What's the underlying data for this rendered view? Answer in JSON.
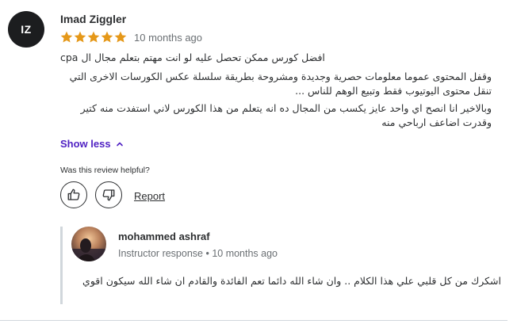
{
  "review": {
    "avatar_initials": "IZ",
    "reviewer_name": "Imad Ziggler",
    "rating": 5,
    "rating_max": 5,
    "time_ago": "10 months ago",
    "paragraphs": [
      "افضل كورس ممكن تحصل عليه لو انت مهتم بتعلم مجال ال cpa",
      "وقفل المحتوى عموما معلومات حصرية وجديدة ومشروحة بطريقة سلسلة عكس الكورسات الاخرى التي تنقل محتوى اليوتيوب فقط وتبيع الوهم للناس ...",
      "وبالاخير انا انصح اي واحد عايز يكسب من المجال ده انه يتعلم من هذا الكورس لاني استفدت منه كتير وقدرت اضاعف ارباحي منه"
    ],
    "show_less_label": "Show less",
    "helpful_question": "Was this review helpful?",
    "report_label": "Report",
    "star_color": "#e59819"
  },
  "instructor_response": {
    "name": "mohammed ashraf",
    "meta": "Instructor response • 10 months ago",
    "reply": "اشكرك من كل قلبي علي هذا الكلام .. وان شاء الله دائما تعم الفائدة والقادم ان شاء الله سيكون اقوي"
  },
  "icons": {
    "star": "star-icon",
    "chevron": "chevron-up-icon",
    "thumbs_up": "thumbs-up-icon",
    "thumbs_down": "thumbs-down-icon"
  },
  "colors": {
    "accent": "#5022c3",
    "avatar_bg": "#1c1d1f",
    "muted_text": "#6a6f73"
  }
}
